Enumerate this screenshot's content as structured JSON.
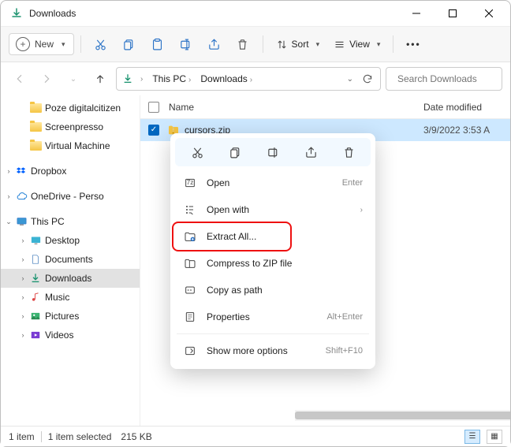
{
  "window": {
    "title": "Downloads"
  },
  "toolbar": {
    "new_label": "New",
    "sort_label": "Sort",
    "view_label": "View"
  },
  "breadcrumb": {
    "item1": "This PC",
    "item2": "Downloads"
  },
  "search": {
    "placeholder": "Search Downloads"
  },
  "tree": {
    "poze": "Poze digitalcitizen",
    "screenpresso": "Screenpresso",
    "vm": "Virtual Machine",
    "dropbox": "Dropbox",
    "onedrive": "OneDrive - Perso",
    "thispc": "This PC",
    "desktop": "Desktop",
    "documents": "Documents",
    "downloads": "Downloads",
    "music": "Music",
    "pictures": "Pictures",
    "videos": "Videos"
  },
  "columns": {
    "name": "Name",
    "date": "Date modified"
  },
  "file": {
    "name": "cursors.zip",
    "date": "3/9/2022 3:53 A"
  },
  "context": {
    "open": "Open",
    "open_sc": "Enter",
    "openwith": "Open with",
    "extract": "Extract All...",
    "compress": "Compress to ZIP file",
    "copypath": "Copy as path",
    "properties": "Properties",
    "properties_sc": "Alt+Enter",
    "more": "Show more options",
    "more_sc": "Shift+F10"
  },
  "status": {
    "count": "1 item",
    "selected": "1 item selected",
    "size": "215 KB"
  }
}
